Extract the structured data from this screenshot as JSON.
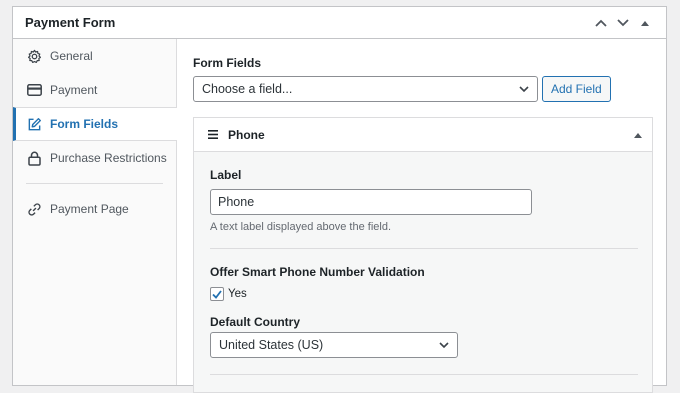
{
  "metabox": {
    "title": "Payment Form"
  },
  "sidebar": {
    "items": [
      {
        "label": "General",
        "icon": "gear-icon"
      },
      {
        "label": "Payment",
        "icon": "card-icon"
      },
      {
        "label": "Form Fields",
        "icon": "edit-icon",
        "active": true
      },
      {
        "label": "Purchase Restrictions",
        "icon": "lock-icon"
      },
      {
        "label": "Payment Page",
        "icon": "link-icon"
      }
    ]
  },
  "main": {
    "form_fields_label": "Form Fields",
    "field_select_value": "Choose a field...",
    "add_field_label": "Add Field",
    "field": {
      "title": "Phone",
      "label_heading": "Label",
      "label_value": "Phone",
      "label_help": "A text label displayed above the field.",
      "validation_heading": "Offer Smart Phone Number Validation",
      "validation_checkbox_label": "Yes",
      "validation_checked": true,
      "country_heading": "Default Country",
      "country_value": "United States (US)"
    }
  },
  "colors": {
    "accent": "#2271b1",
    "border": "#c3c4c7",
    "text": "#1d2327"
  }
}
